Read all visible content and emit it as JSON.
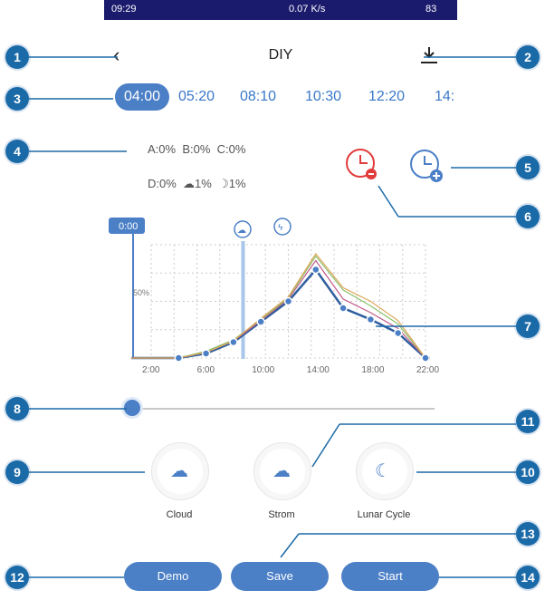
{
  "status": {
    "time": "09:29",
    "speed": "0.07 K/s",
    "battery": "83"
  },
  "header": {
    "title": "DIY"
  },
  "tabs": [
    "04:00",
    "05:20",
    "08:10",
    "10:30",
    "12:20",
    "14:"
  ],
  "channels": {
    "line1": [
      {
        "label": "A:",
        "value": "0%"
      },
      {
        "label": "B:",
        "value": "0%"
      },
      {
        "label": "C:",
        "value": "0%"
      }
    ],
    "line2": [
      {
        "label": "D:",
        "value": "0%"
      },
      {
        "label": "cloud",
        "value": "1%"
      },
      {
        "label": "moon",
        "value": "1%"
      }
    ]
  },
  "chart_data": {
    "type": "line",
    "time_label": "0:00",
    "x_ticks": [
      "2:00",
      "6:00",
      "10:00",
      "14:00",
      "18:00",
      "22:00"
    ],
    "y_mark": "50%",
    "x": [
      2,
      4,
      6,
      8,
      10,
      12,
      14,
      16,
      18,
      20,
      22
    ],
    "series": [
      {
        "values": [
          0,
          0,
          4,
          14,
          32,
          50,
          78,
          44,
          34,
          22,
          0
        ]
      },
      {
        "values": [
          0,
          0,
          5,
          15,
          33,
          52,
          86,
          52,
          40,
          26,
          0
        ]
      },
      {
        "values": [
          0,
          0,
          6,
          16,
          34,
          53,
          90,
          60,
          46,
          30,
          0
        ]
      },
      {
        "values": [
          0,
          0,
          5,
          15,
          35,
          54,
          92,
          62,
          50,
          33,
          0
        ]
      }
    ],
    "ylim": [
      0,
      100
    ],
    "cursor_x": 8.7
  },
  "buttons": {
    "cloud": "Cloud",
    "storm": "Strom",
    "lunar": "Lunar Cycle",
    "demo": "Demo",
    "save": "Save",
    "start": "Start"
  },
  "callouts": [
    "1",
    "2",
    "3",
    "4",
    "5",
    "6",
    "7",
    "8",
    "9",
    "10",
    "11",
    "12",
    "13",
    "14"
  ]
}
